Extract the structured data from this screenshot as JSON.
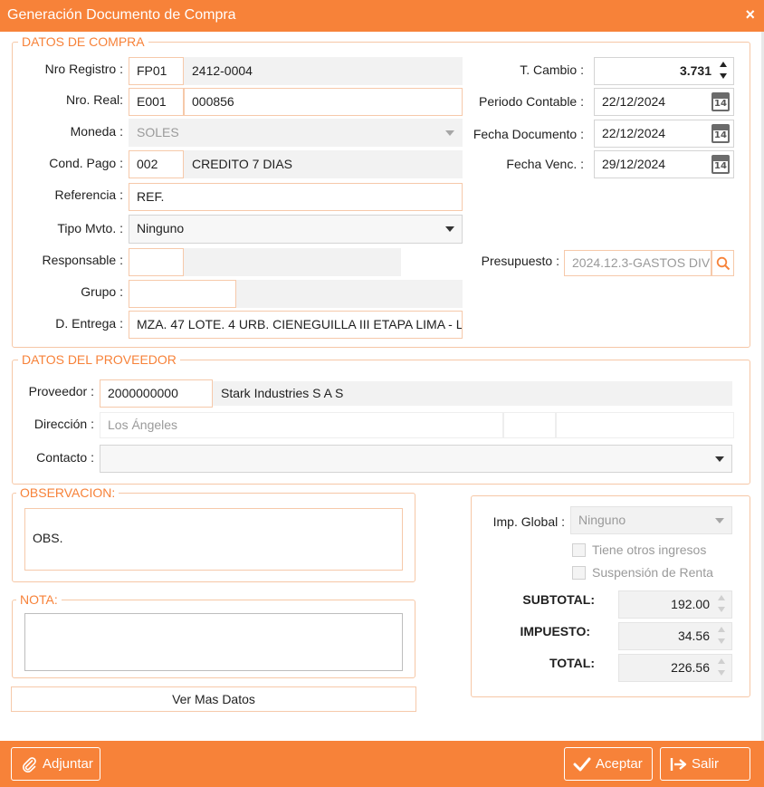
{
  "window": {
    "title": "Generación Documento de Compra",
    "close_icon": "×"
  },
  "colors": {
    "accent": "#f78239",
    "border": "#f6c9aa",
    "readonly_bg": "#f2f2f2"
  },
  "compra": {
    "legend": "DATOS DE COMPRA",
    "nro_registro": {
      "label": "Nro Registro :",
      "serie": "FP01",
      "numero": "2412-0004"
    },
    "nro_real": {
      "label": "Nro. Real:",
      "serie": "E001",
      "numero": "000856"
    },
    "moneda": {
      "label": "Moneda :",
      "value": "SOLES"
    },
    "cond_pago": {
      "label": "Cond. Pago :",
      "code": "002",
      "desc": "CREDITO 7 DIAS"
    },
    "referencia": {
      "label": "Referencia :",
      "value": "REF."
    },
    "tipo_mvto": {
      "label": "Tipo Mvto. :",
      "value": "Ninguno"
    },
    "responsable": {
      "label": "Responsable :",
      "code": "",
      "desc": ""
    },
    "grupo": {
      "label": "Grupo :",
      "code": "",
      "desc": ""
    },
    "d_entrega": {
      "label": "D. Entrega :",
      "value": "MZA. 47 LOTE. 4 URB. CIENEGUILLA III ETAPA LIMA - L"
    },
    "t_cambio": {
      "label": "T. Cambio :",
      "value": "3.731"
    },
    "periodo_contable": {
      "label": "Periodo Contable :",
      "value": "22/12/2024"
    },
    "fecha_documento": {
      "label": "Fecha Documento :",
      "value": "22/12/2024"
    },
    "fecha_venc": {
      "label": "Fecha Venc. :",
      "value": "29/12/2024"
    },
    "calendar_day": "14",
    "presupuesto": {
      "label": "Presupuesto :",
      "value": "2024.12.3-GASTOS DIV"
    }
  },
  "proveedor": {
    "legend": "DATOS DEL PROVEEDOR",
    "proveedor": {
      "label": "Proveedor :",
      "code": "2000000000",
      "name": "Stark Industries S A S"
    },
    "direccion": {
      "label": "Dirección :",
      "value": "Los Ángeles",
      "extra1": "",
      "extra2": ""
    },
    "contacto": {
      "label": "Contacto :",
      "value": ""
    }
  },
  "observacion": {
    "legend": "OBSERVACION:",
    "text": "OBS."
  },
  "nota": {
    "legend": "NOTA:",
    "text": ""
  },
  "ver_mas_datos": "Ver Mas Datos",
  "impuestos": {
    "imp_global": {
      "label": "Imp. Global :",
      "value": "Ninguno"
    },
    "otros_ingresos": "Tiene otros ingresos",
    "suspension_renta": "Suspensión de Renta",
    "subtotal": {
      "label": "SUBTOTAL:",
      "value": "192.00"
    },
    "impuesto": {
      "label": "IMPUESTO:",
      "value": "34.56"
    },
    "total": {
      "label": "TOTAL:",
      "value": "226.56"
    }
  },
  "footer": {
    "adjuntar": "Adjuntar",
    "aceptar": "Aceptar",
    "salir": "Salir"
  }
}
